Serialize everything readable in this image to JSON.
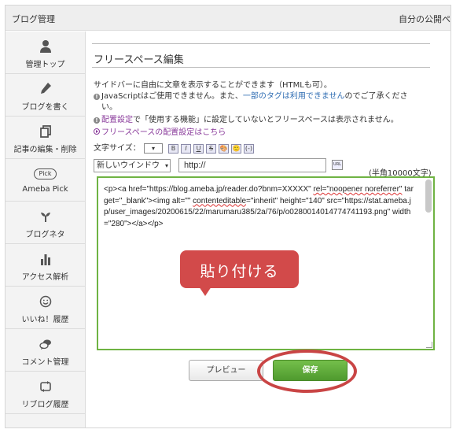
{
  "topbar": {
    "title": "ブログ管理",
    "public_link": "自分の公開ペ"
  },
  "sidebar": {
    "items": [
      {
        "label": "管理トップ",
        "icon": "user-icon"
      },
      {
        "label": "ブログを書く",
        "icon": "pen-icon"
      },
      {
        "label": "記事の編集・削除",
        "icon": "copy-icon"
      },
      {
        "label": "Ameba Pick",
        "icon": "pick-icon",
        "badge": "Pick"
      },
      {
        "label": "ブログネタ",
        "icon": "sprout-icon"
      },
      {
        "label": "アクセス解析",
        "icon": "bar-chart-icon"
      },
      {
        "label": "いいね！履歴",
        "icon": "smile-icon"
      },
      {
        "label": "コメント管理",
        "icon": "comment-icon"
      },
      {
        "label": "リブログ履歴",
        "icon": "reblog-icon"
      }
    ]
  },
  "main": {
    "title": "フリースペース編集",
    "description": "サイドバーに自由に文章を表示することができます（HTMLも可）。",
    "notice1_part1": "JavaScriptはご使用できません。また、",
    "notice1_link": "一部のタグは利用できません",
    "notice1_part2": "のでご了承くださ",
    "notice1_part3": "い。",
    "notice2_link": "配置設定",
    "notice2_text": "で「使用する機能」に設定していないとフリースペースは表示されません。",
    "placement_link": "フリースペースの配置設定はこちら",
    "font_size_label": "文字サイズ：",
    "format_buttons": [
      "B",
      "I",
      "U",
      "S",
      "🎨",
      "🙂",
      "(-)"
    ],
    "window_select": "新しいウインドウ",
    "url_value": "http://",
    "url_button": "URL",
    "char_limit": "(半角10000文字)",
    "editor_content_a": "<p><a href=\"https://blog.ameba.jp/reader.do?bnm=XXXXX\" ",
    "editor_content_b": "rel=\"noopener noreferrer\"",
    "editor_content_c": " target=\"_blank\"><img alt=\"\" ",
    "editor_content_d": "contenteditable",
    "editor_content_e": "=\"inherit\" height=\"140\" src=\"https://stat.ameba.jp/user_images/20200615/22/marumaru385/2a/76/p/o0280014014774741193.png\" width=\"280\"></a></p>",
    "paste_callout": "貼り付ける",
    "preview_label": "プレビュー",
    "save_label": "保存"
  },
  "colors": {
    "accent_green": "#5ea83a",
    "callout_red": "#d24a4a",
    "link_blue": "#2f6db3",
    "link_purple": "#8a3b9b"
  }
}
